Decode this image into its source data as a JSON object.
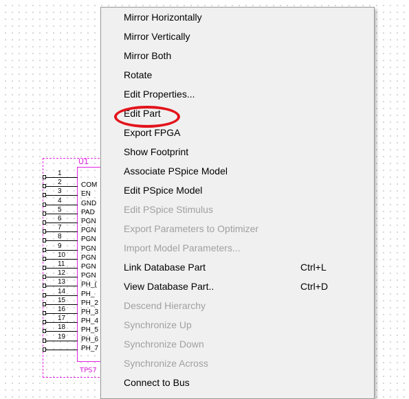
{
  "part": {
    "refdes": "U1",
    "value": "TPS7",
    "pins": [
      {
        "num": "1",
        "name": ""
      },
      {
        "num": "2",
        "name": "COM"
      },
      {
        "num": "3",
        "name": "EN"
      },
      {
        "num": "4",
        "name": "GND"
      },
      {
        "num": "5",
        "name": "PAD"
      },
      {
        "num": "6",
        "name": "PGN"
      },
      {
        "num": "7",
        "name": "PGN"
      },
      {
        "num": "8",
        "name": "PGN"
      },
      {
        "num": "9",
        "name": "PGN"
      },
      {
        "num": "10",
        "name": "PGN"
      },
      {
        "num": "11",
        "name": "PGN"
      },
      {
        "num": "12",
        "name": "PGN"
      },
      {
        "num": "13",
        "name": "PH_("
      },
      {
        "num": "14",
        "name": "PH_"
      },
      {
        "num": "15",
        "name": "PH_2"
      },
      {
        "num": "16",
        "name": "PH_3"
      },
      {
        "num": "17",
        "name": "PH_4"
      },
      {
        "num": "18",
        "name": "PH_5"
      },
      {
        "num": "19",
        "name": "PH_6"
      },
      {
        "num": "",
        "name": "PH_7"
      }
    ]
  },
  "menu": {
    "items": [
      {
        "label": "Mirror Horizontally",
        "enabled": true,
        "shortcut": ""
      },
      {
        "label": "Mirror Vertically",
        "enabled": true,
        "shortcut": ""
      },
      {
        "label": "Mirror Both",
        "enabled": true,
        "shortcut": ""
      },
      {
        "label": "Rotate",
        "enabled": true,
        "shortcut": ""
      },
      {
        "label": "Edit Properties...",
        "enabled": true,
        "shortcut": ""
      },
      {
        "label": "Edit Part",
        "enabled": true,
        "shortcut": ""
      },
      {
        "label": "Export FPGA",
        "enabled": true,
        "shortcut": ""
      },
      {
        "label": "Show Footprint",
        "enabled": true,
        "shortcut": ""
      },
      {
        "label": "Associate PSpice Model",
        "enabled": true,
        "shortcut": ""
      },
      {
        "label": "Edit PSpice Model",
        "enabled": true,
        "shortcut": ""
      },
      {
        "label": "Edit PSpice Stimulus",
        "enabled": false,
        "shortcut": ""
      },
      {
        "label": "Export Parameters to Optimizer",
        "enabled": false,
        "shortcut": ""
      },
      {
        "label": "Import Model Parameters...",
        "enabled": false,
        "shortcut": ""
      },
      {
        "label": "Link Database Part",
        "enabled": true,
        "shortcut": "Ctrl+L"
      },
      {
        "label": "View Database Part..",
        "enabled": true,
        "shortcut": "Ctrl+D"
      },
      {
        "label": "Descend Hierarchy",
        "enabled": false,
        "shortcut": ""
      },
      {
        "label": "Synchronize Up",
        "enabled": false,
        "shortcut": ""
      },
      {
        "label": "Synchronize Down",
        "enabled": false,
        "shortcut": ""
      },
      {
        "label": "Synchronize Across",
        "enabled": false,
        "shortcut": ""
      },
      {
        "label": "Connect to Bus",
        "enabled": true,
        "shortcut": ""
      }
    ]
  }
}
